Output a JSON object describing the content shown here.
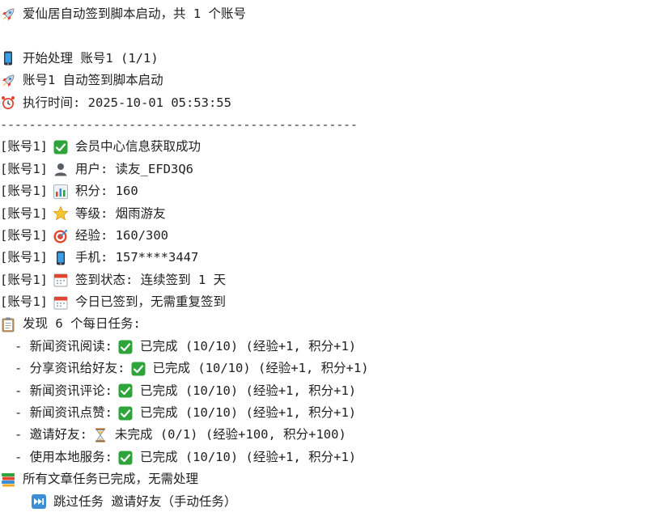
{
  "colors": {
    "check_green": "#2fa43a",
    "rocket_red": "#e0452f",
    "text": "#1f1f1f"
  },
  "console": {
    "start_line": "爱仙居自动签到脚本启动，共 1 个账号",
    "processing_line": "开始处理 账号1 (1/1)",
    "account_start_line": "账号1 自动签到脚本启动",
    "exec_time_line": "执行时间: 2025-10-01 05:53:55",
    "separator": "--------------------------------------------------",
    "account_prefix": "[账号1]",
    "member_info": "会员中心信息获取成功",
    "user_line": "用户: 读友_EFD3Q6",
    "points_line": "积分: 160",
    "level_line": "等级: 烟雨游友",
    "exp_line": "经验: 160/300",
    "phone_line": "手机: 157****3447",
    "signin_status_line": "签到状态: 连续签到 1 天",
    "signed_today_line": "今日已签到，无需重复签到",
    "tasks_found_line": "发现 6 个每日任务:",
    "tasks": [
      {
        "label": "- 新闻资讯阅读:",
        "status_icon": "check-icon",
        "status": "已完成 (10/10) (经验+1, 积分+1)"
      },
      {
        "label": "- 分享资讯给好友:",
        "status_icon": "check-icon",
        "status": "已完成 (10/10) (经验+1, 积分+1)"
      },
      {
        "label": "- 新闻资讯评论:",
        "status_icon": "check-icon",
        "status": "已完成 (10/10) (经验+1, 积分+1)"
      },
      {
        "label": "- 新闻资讯点赞:",
        "status_icon": "check-icon",
        "status": "已完成 (10/10) (经验+1, 积分+1)"
      },
      {
        "label": "- 邀请好友:",
        "status_icon": "hourglass-icon",
        "status": "未完成 (0/1) (经验+100, 积分+100)"
      },
      {
        "label": "- 使用本地服务:",
        "status_icon": "check-icon",
        "status": "已完成 (10/10) (经验+1, 积分+1)"
      }
    ],
    "articles_done_line": "所有文章任务已完成，无需处理",
    "skip_task_line": "跳过任务 邀请好友（手动任务）"
  },
  "icons": {
    "start": "rocket-icon",
    "processing": "mobile-phone-icon",
    "account_start": "rocket-icon",
    "exec_time": "alarm-clock-icon",
    "member_info": "check-icon",
    "user": "person-silhouette-icon",
    "points": "bar-chart-icon",
    "level": "star-icon",
    "exp": "target-icon",
    "phone": "mobile-phone-icon",
    "signin_status": "calendar-icon",
    "signed_today": "calendar-icon",
    "tasks_found": "clipboard-icon",
    "articles_done": "books-icon",
    "skip_task": "fast-forward-icon"
  }
}
